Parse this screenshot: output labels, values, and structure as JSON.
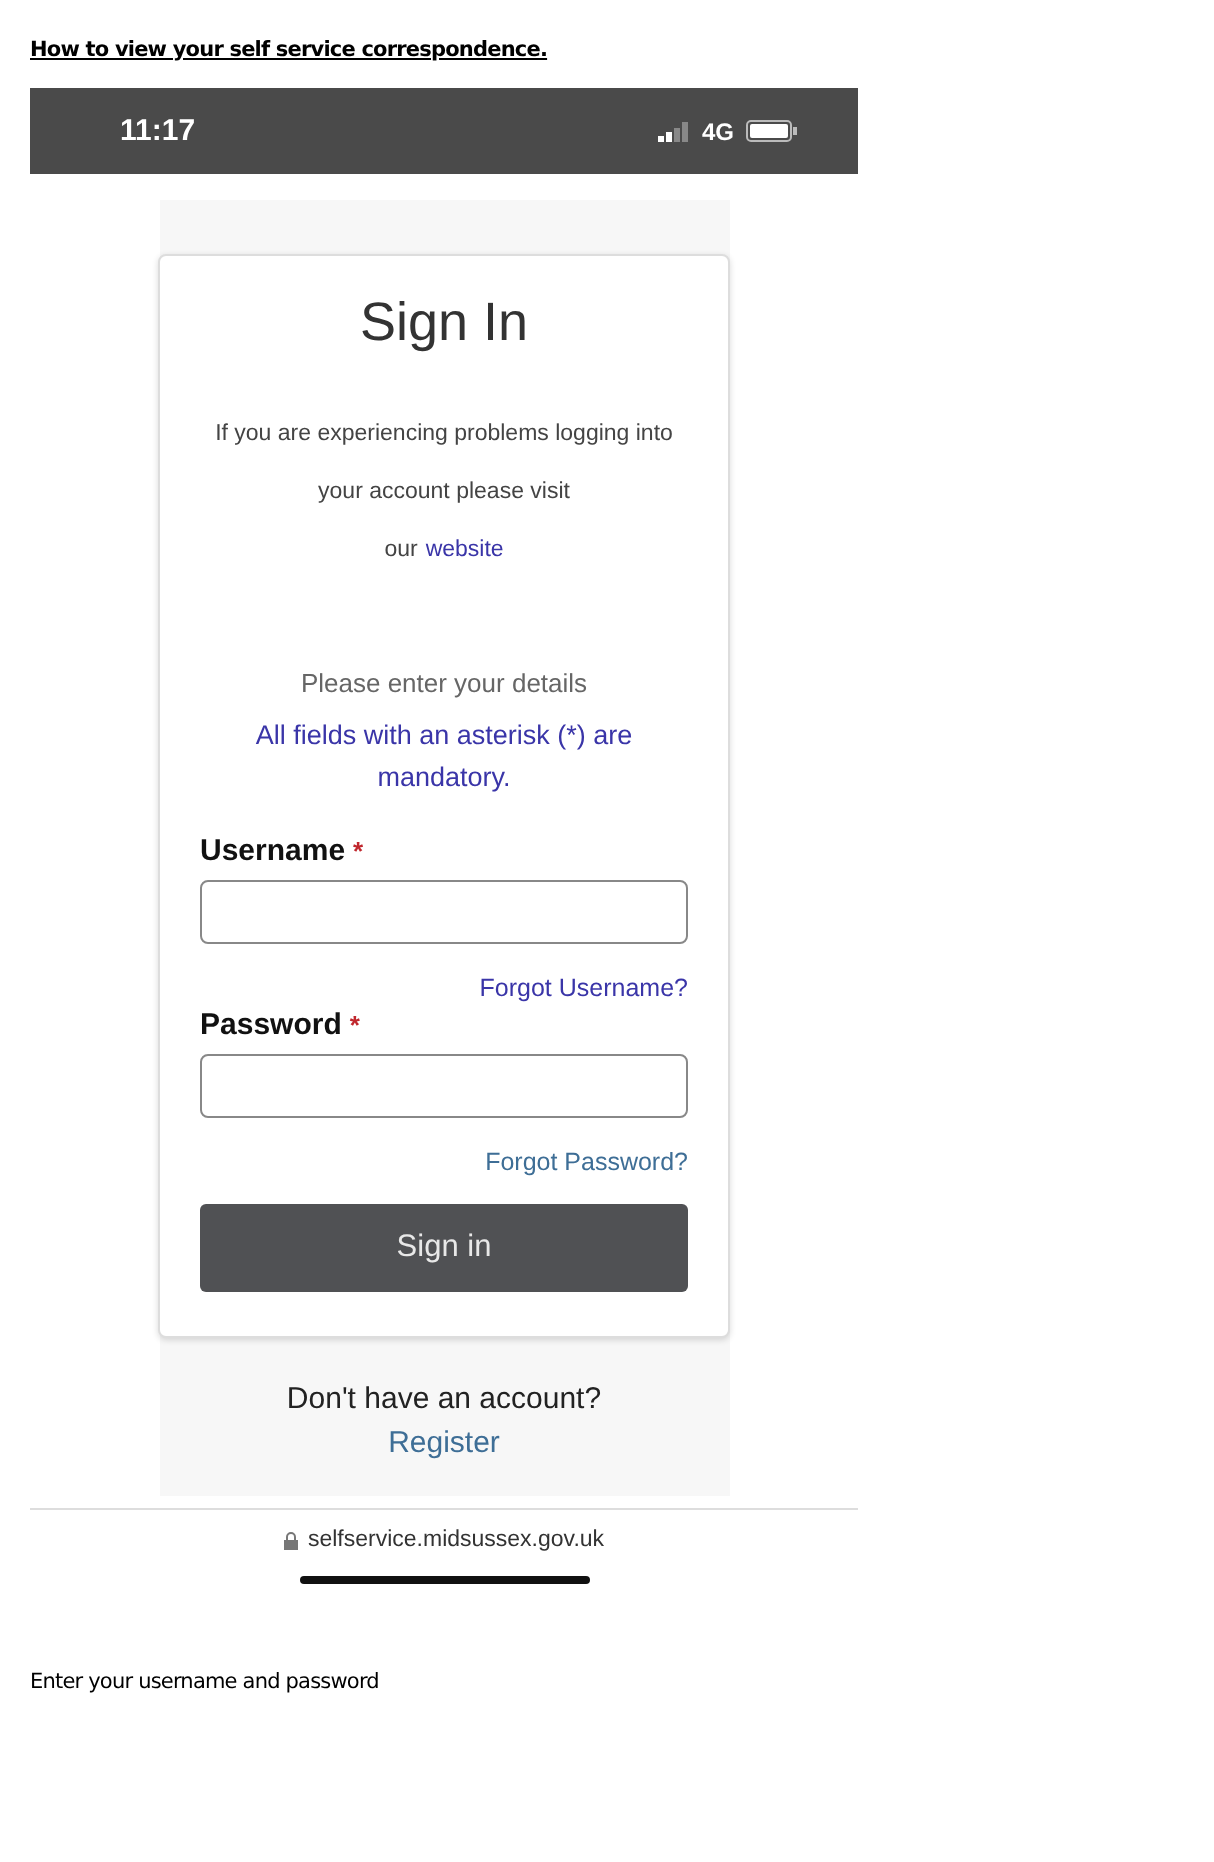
{
  "document": {
    "heading": "How to view your self service correspondence.",
    "caption": "Enter your username and password"
  },
  "status_bar": {
    "time": "11:17",
    "network": "4G"
  },
  "sign_in": {
    "title": "Sign In",
    "notice": "If you are experiencing problems logging into your account please visit",
    "notice_tail": "our",
    "notice_link": "website",
    "prompt": "Please enter your details",
    "mandatory_note": "All fields with an asterisk (*) are mandatory.",
    "fields": [
      {
        "label": "Username",
        "required_mark": "*",
        "link": "Forgot Username?"
      },
      {
        "label": "Password",
        "required_mark": "*",
        "link": "Forgot Password?"
      }
    ],
    "submit": "Sign in"
  },
  "register": {
    "question": "Don't have an account?",
    "link": "Register"
  },
  "browser": {
    "url": "selfservice.midsussex.gov.uk"
  }
}
